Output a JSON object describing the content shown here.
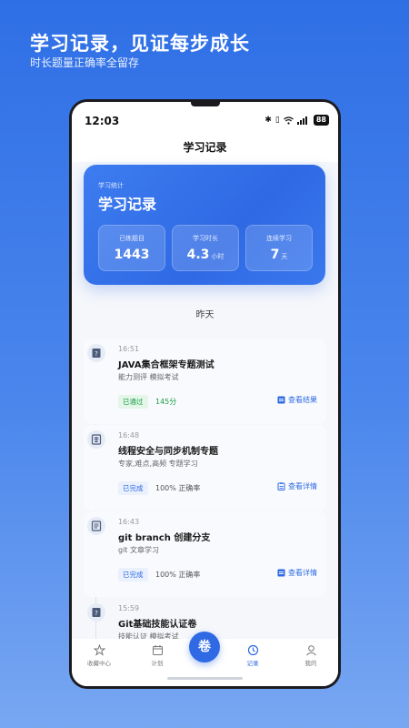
{
  "promo": {
    "title": "学习记录，见证每步成长",
    "subtitle": "时长题量正确率全留存"
  },
  "status_bar": {
    "time": "12:03",
    "battery": "88"
  },
  "nav": {
    "title": "学习记录"
  },
  "stats_card": {
    "eyebrow": "学习统计",
    "title": "学习记录",
    "stats": [
      {
        "label": "已练题目",
        "value": "1443",
        "unit": ""
      },
      {
        "label": "学习时长",
        "value": "4.3",
        "unit": "小时"
      },
      {
        "label": "连续学习",
        "value": "7",
        "unit": "天"
      }
    ]
  },
  "date_header": "昨天",
  "entries": [
    {
      "icon": "question-icon",
      "time": "16:51",
      "title": "JAVA集合框架专题测试",
      "tags": "能力测评  模拟考试",
      "status": "已通过",
      "status_color": "#1a9b45",
      "metric": "145分",
      "action": "查看结果"
    },
    {
      "icon": "book-icon",
      "time": "16:48",
      "title": "线程安全与同步机制专题",
      "tags": "专家,难点,高频  专题学习",
      "status": "已完成",
      "status_color": "#2f6ae4",
      "metric": "100% 正确率",
      "action": "查看详情"
    },
    {
      "icon": "document-icon",
      "time": "16:43",
      "title": "git branch 创建分支",
      "tags": "git  文章学习",
      "status": "已完成",
      "status_color": "#2f6ae4",
      "metric": "100% 正确率",
      "action": "查看详情"
    },
    {
      "icon": "question-icon",
      "time": "15:59",
      "title": "Git基础技能认证卷",
      "tags": "技能认证  模拟考试"
    }
  ],
  "tabbar": {
    "tabs": [
      {
        "label": "收藏中心",
        "icon": "star-icon"
      },
      {
        "label": "计划",
        "icon": "calendar-icon"
      },
      {
        "label": "记录",
        "icon": "clock-icon",
        "active": true
      },
      {
        "label": "我的",
        "icon": "user-icon"
      }
    ],
    "fab_label": "卷"
  },
  "colors": {
    "accent": "#2f6ae4",
    "success": "#1a9b45"
  }
}
